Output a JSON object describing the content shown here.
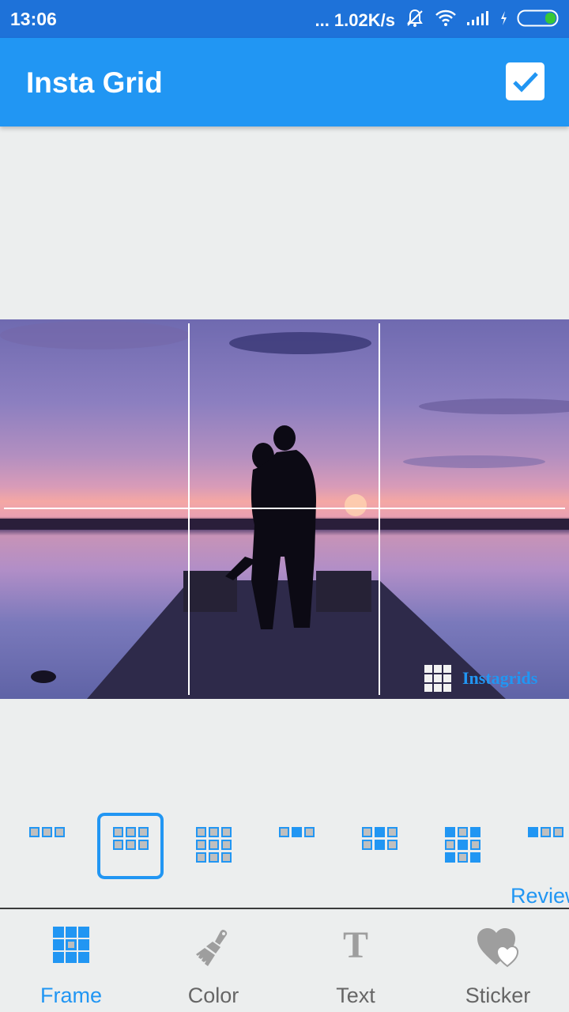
{
  "status_bar": {
    "time": "13:06",
    "network_speed": "... 1.02K/s",
    "icons": [
      "mute-icon",
      "wifi-icon",
      "signal-icon",
      "charging-icon",
      "battery-icon"
    ]
  },
  "app_bar": {
    "title": "Insta Grid",
    "confirm_icon": "check-icon"
  },
  "photo": {
    "description": "Couple silhouette kissing on pier at sunset",
    "grid_columns": 3,
    "grid_rows": 2,
    "watermark": {
      "icon": "grid-icon",
      "text": "Instagrids"
    }
  },
  "layouts": {
    "selected_index": 1,
    "items": [
      {
        "name": "grid-3x1",
        "cols": 3,
        "rows": 1,
        "filled": []
      },
      {
        "name": "grid-3x2",
        "cols": 3,
        "rows": 2,
        "filled": []
      },
      {
        "name": "grid-3x3",
        "cols": 3,
        "rows": 3,
        "filled": []
      },
      {
        "name": "grid-3x1-center",
        "cols": 3,
        "rows": 1,
        "filled": [
          1
        ]
      },
      {
        "name": "grid-3x2-center",
        "cols": 3,
        "rows": 2,
        "filled": [
          1,
          4
        ]
      },
      {
        "name": "grid-3x3-x",
        "cols": 3,
        "rows": 3,
        "filled": [
          0,
          2,
          4,
          6,
          8
        ]
      },
      {
        "name": "grid-3x1-left",
        "cols": 3,
        "rows": 1,
        "filled": [
          0
        ]
      }
    ],
    "review_link": "Review"
  },
  "tabs": [
    {
      "label": "Frame",
      "icon": "frame-grid-icon",
      "active": true
    },
    {
      "label": "Color",
      "icon": "paint-brush-icon",
      "active": false
    },
    {
      "label": "Text",
      "icon": "text-t-icon",
      "active": false
    },
    {
      "label": "Sticker",
      "icon": "hearts-icon",
      "active": false
    }
  ],
  "colors": {
    "status_bar": "#1e72d9",
    "accent": "#2196f3",
    "background": "#eceeee",
    "inactive_icon": "#9e9e9e"
  }
}
